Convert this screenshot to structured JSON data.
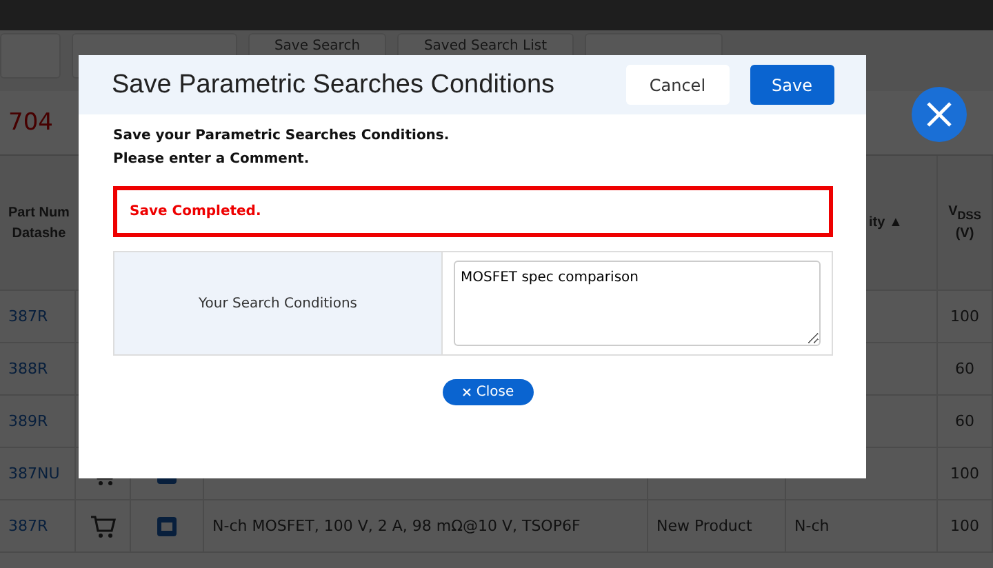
{
  "page": {
    "toolbar": [
      "Save Search",
      "Saved Search List"
    ],
    "result_count": "704",
    "table": {
      "headers": [
        {
          "kind": "part",
          "lines": [
            "Part Num",
            "Datashe"
          ]
        },
        {
          "kind": "polarity",
          "lines": [
            "ity ▲"
          ]
        },
        {
          "kind": "vdss",
          "lines": [
            "V$_{DSS}$",
            "(V)"
          ]
        }
      ],
      "rows": [
        {
          "part": "387R",
          "description": "",
          "status": "",
          "polarity": "",
          "vdss": "100",
          "cart": false
        },
        {
          "part": "388R",
          "description": "",
          "status": "",
          "polarity": "",
          "vdss": "60",
          "cart": false
        },
        {
          "part": "389R",
          "description": "",
          "status": "",
          "polarity": "",
          "vdss": "60",
          "cart": false
        },
        {
          "part": "387NU",
          "description": "",
          "status": "",
          "polarity": "",
          "vdss": "100",
          "cart": true
        },
        {
          "part": "387R",
          "description": "N-ch MOSFET, 100 V, 2 A, 98 mΩ@10 V, TSOP6F",
          "status": "New Product",
          "polarity": "N-ch",
          "vdss": "100",
          "cart": true
        }
      ]
    }
  },
  "dialog": {
    "title": "Save Parametric Searches Conditions",
    "buttons": [
      {
        "label": "Cancel",
        "kind": "secondary"
      },
      {
        "label": "Save",
        "kind": "primary"
      }
    ],
    "intro": [
      "Save your Parametric Searches Conditions.",
      "Please enter a Comment."
    ],
    "message": "Save Completed.",
    "form": {
      "label": "Your Search Conditions",
      "value": "MOSFET spec comparison"
    },
    "close_label": "Close"
  }
}
